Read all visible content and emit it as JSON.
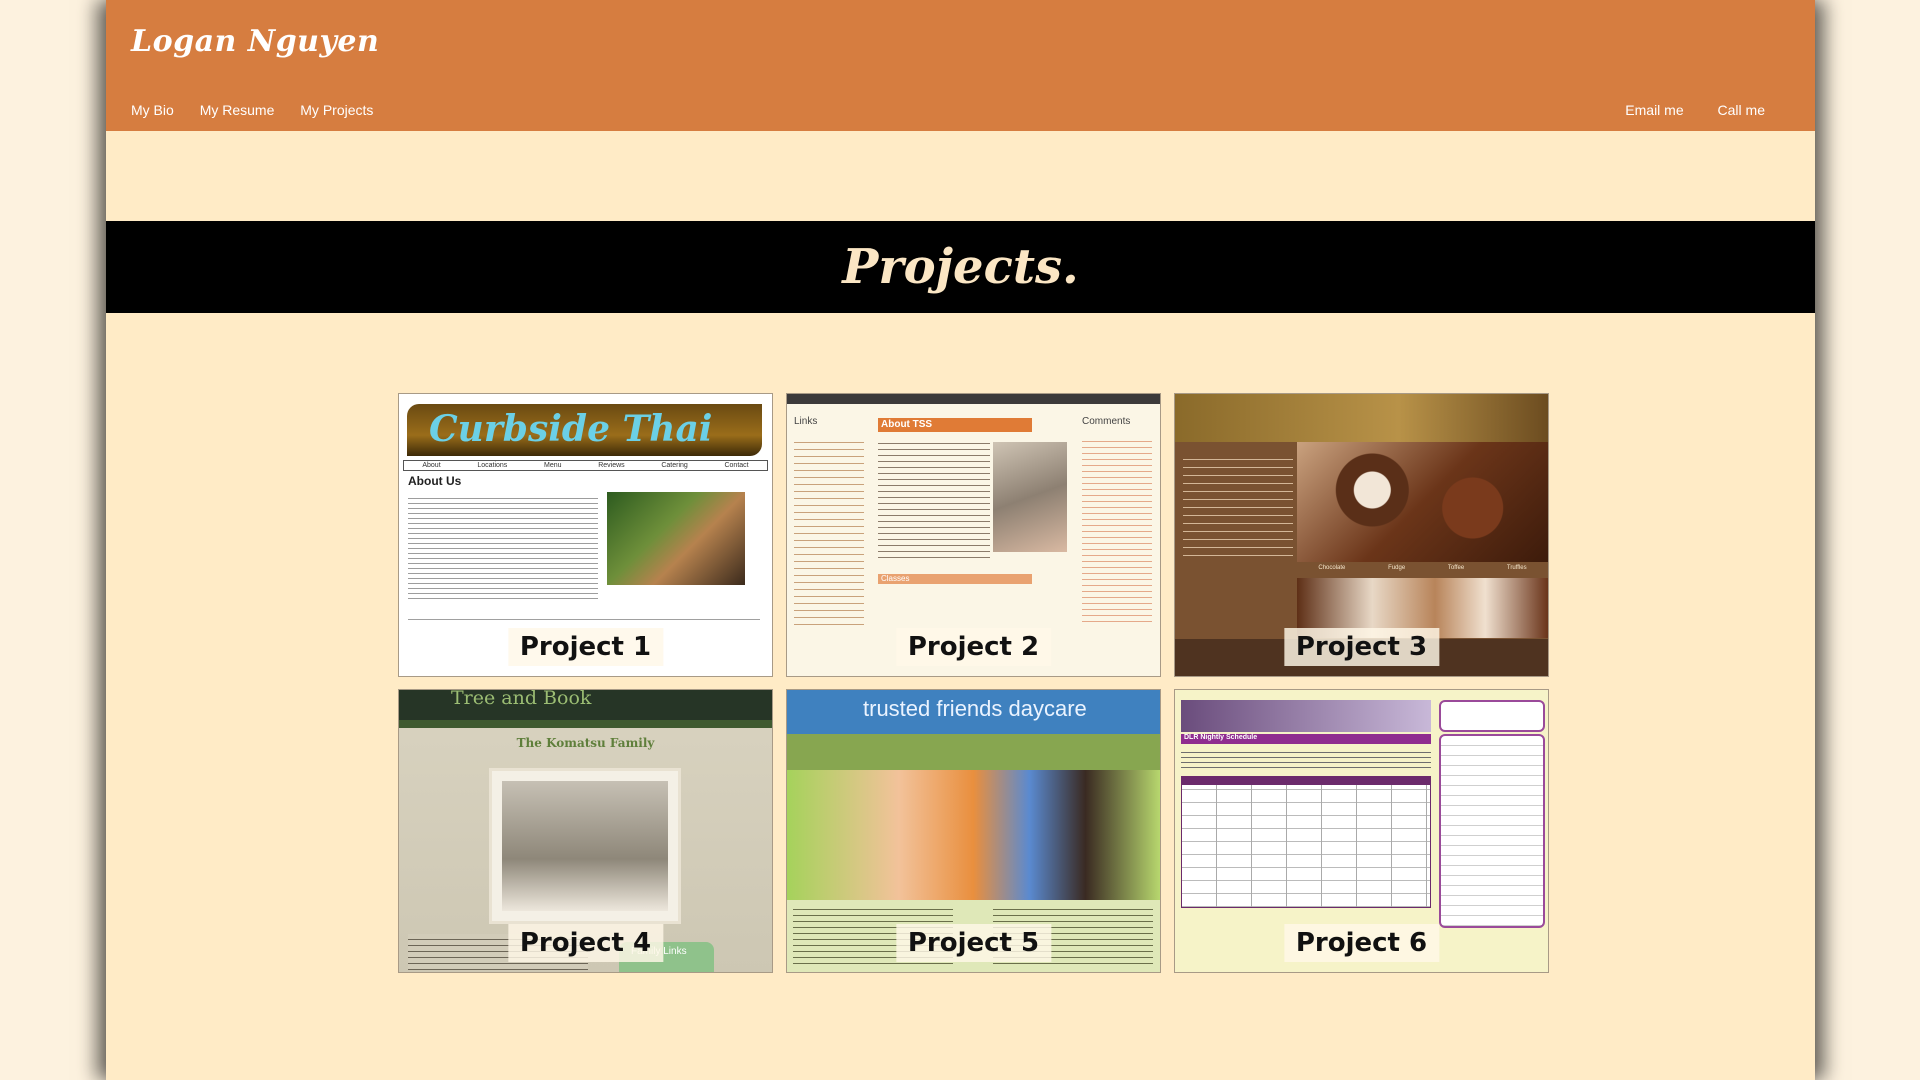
{
  "site": {
    "title": "Logan Nguyen"
  },
  "nav": {
    "left": [
      "My Bio",
      "My Resume",
      "My Projects"
    ],
    "right": [
      "Email me",
      "Call me"
    ]
  },
  "banner": {
    "title": "Projects."
  },
  "projects": [
    {
      "label": "Project 1"
    },
    {
      "label": "Project 2"
    },
    {
      "label": "Project 3"
    },
    {
      "label": "Project 4"
    },
    {
      "label": "Project 5"
    },
    {
      "label": "Project 6"
    }
  ],
  "thumbnails": {
    "p1": {
      "brand": "Curbside Thai",
      "menu": [
        "About",
        "Locations",
        "Menu",
        "Reviews",
        "Catering",
        "Contact"
      ],
      "heading": "About Us"
    },
    "p2": {
      "links_heading": "Links",
      "about_heading": "About TSS",
      "comments_heading": "Comments",
      "classes_heading": "Classes"
    },
    "p3": {
      "categories": [
        "Chocolate",
        "Fudge",
        "Toffee",
        "Truffles"
      ]
    },
    "p4": {
      "brand": "Tree and Book",
      "family": "The Komatsu Family",
      "links": "Family Links"
    },
    "p5": {
      "brand": "trusted friends daycare"
    },
    "p6": {
      "schedule": "DLR Nightly Schedule"
    }
  },
  "colors": {
    "header": "#d67d40",
    "page": "#ffebc6",
    "banner": "#000000",
    "outer": "#fdf2df"
  }
}
